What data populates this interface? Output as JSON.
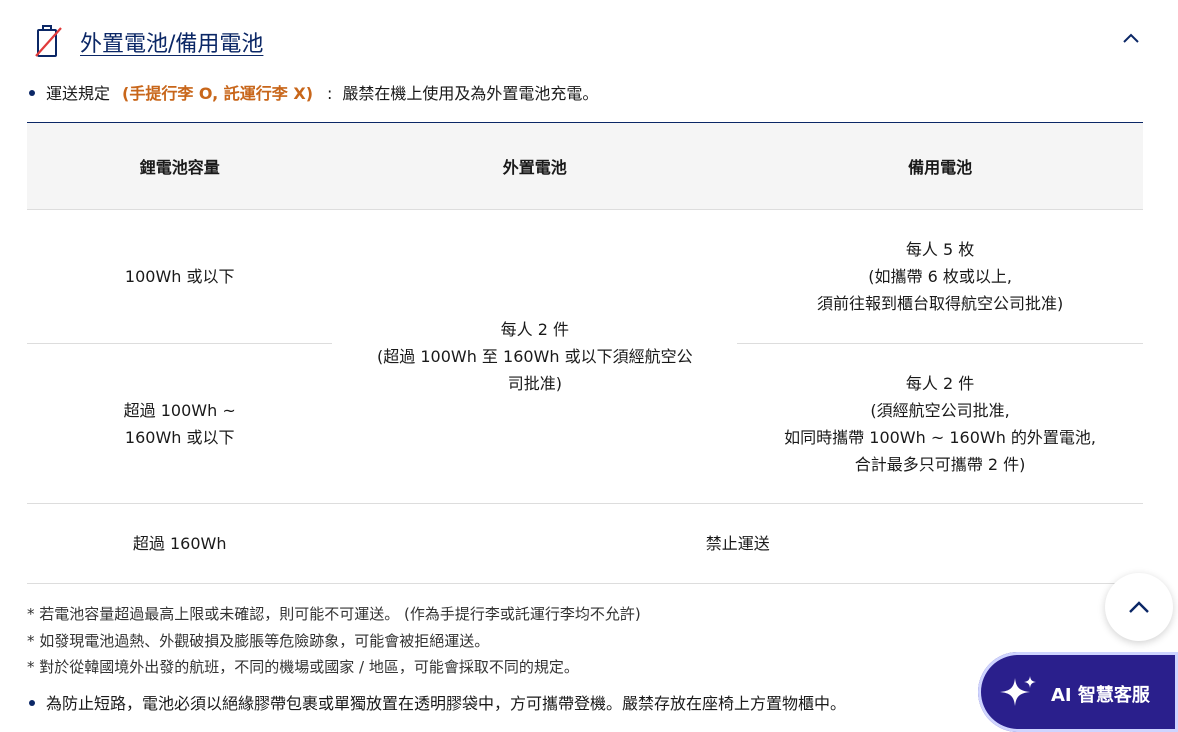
{
  "section": {
    "title": "外置電池/備用電池",
    "icon": "battery-prohibited-icon",
    "collapse_icon": "chevron-up-icon"
  },
  "rule": {
    "label": "運送規定",
    "highlight": "(手提行李 O, 託運行李 X)",
    "colon": ":",
    "text": "嚴禁在機上使用及為外置電池充電。"
  },
  "table": {
    "headers": [
      "鋰電池容量",
      "外置電池",
      "備用電池"
    ],
    "row1_capacity": "100Wh 或以下",
    "row1_spare": [
      "每人 5 枚",
      "(如攜帶 6 枚或以上,",
      "須前往報到櫃台取得航空公司批准)"
    ],
    "external_merged": [
      "每人 2 件",
      "(超過 100Wh 至 160Wh 或以下須經航空公",
      "司批准)"
    ],
    "row2_capacity": [
      "超過 100Wh ~",
      "160Wh 或以下"
    ],
    "row2_spare": [
      "每人 2 件",
      "(須經航空公司批准,",
      "如同時攜帶 100Wh ~ 160Wh 的外置電池,",
      "合計最多只可攜帶 2 件)"
    ],
    "row3_capacity": "超過 160Wh",
    "row3_value": "禁止運送"
  },
  "notes": [
    "* 若電池容量超過最高上限或未確認，則可能不可運送。 (作為手提行李或託運行李均不允許)",
    "* 如發現電池過熱、外觀破損及膨脹等危險跡象，可能會被拒絕運送。",
    "* 對於從韓國境外出發的航班，不同的機場或國家 / 地區，可能會採取不同的規定。"
  ],
  "final_rule": "為防止短路，電池必須以絕緣膠帶包裹或單獨放置在透明膠袋中，方可攜帶登機。嚴禁存放在座椅上方置物櫃中。",
  "floating": {
    "scroll_top_icon": "chevron-up-icon",
    "ai_label": "AI 智慧客服",
    "ai_icon": "sparkle-icon"
  },
  "colors": {
    "navy": "#0b2766",
    "highlight_orange": "#c8661a",
    "header_bg": "#f5f5f5",
    "ai_button": "#2a1f8c"
  }
}
